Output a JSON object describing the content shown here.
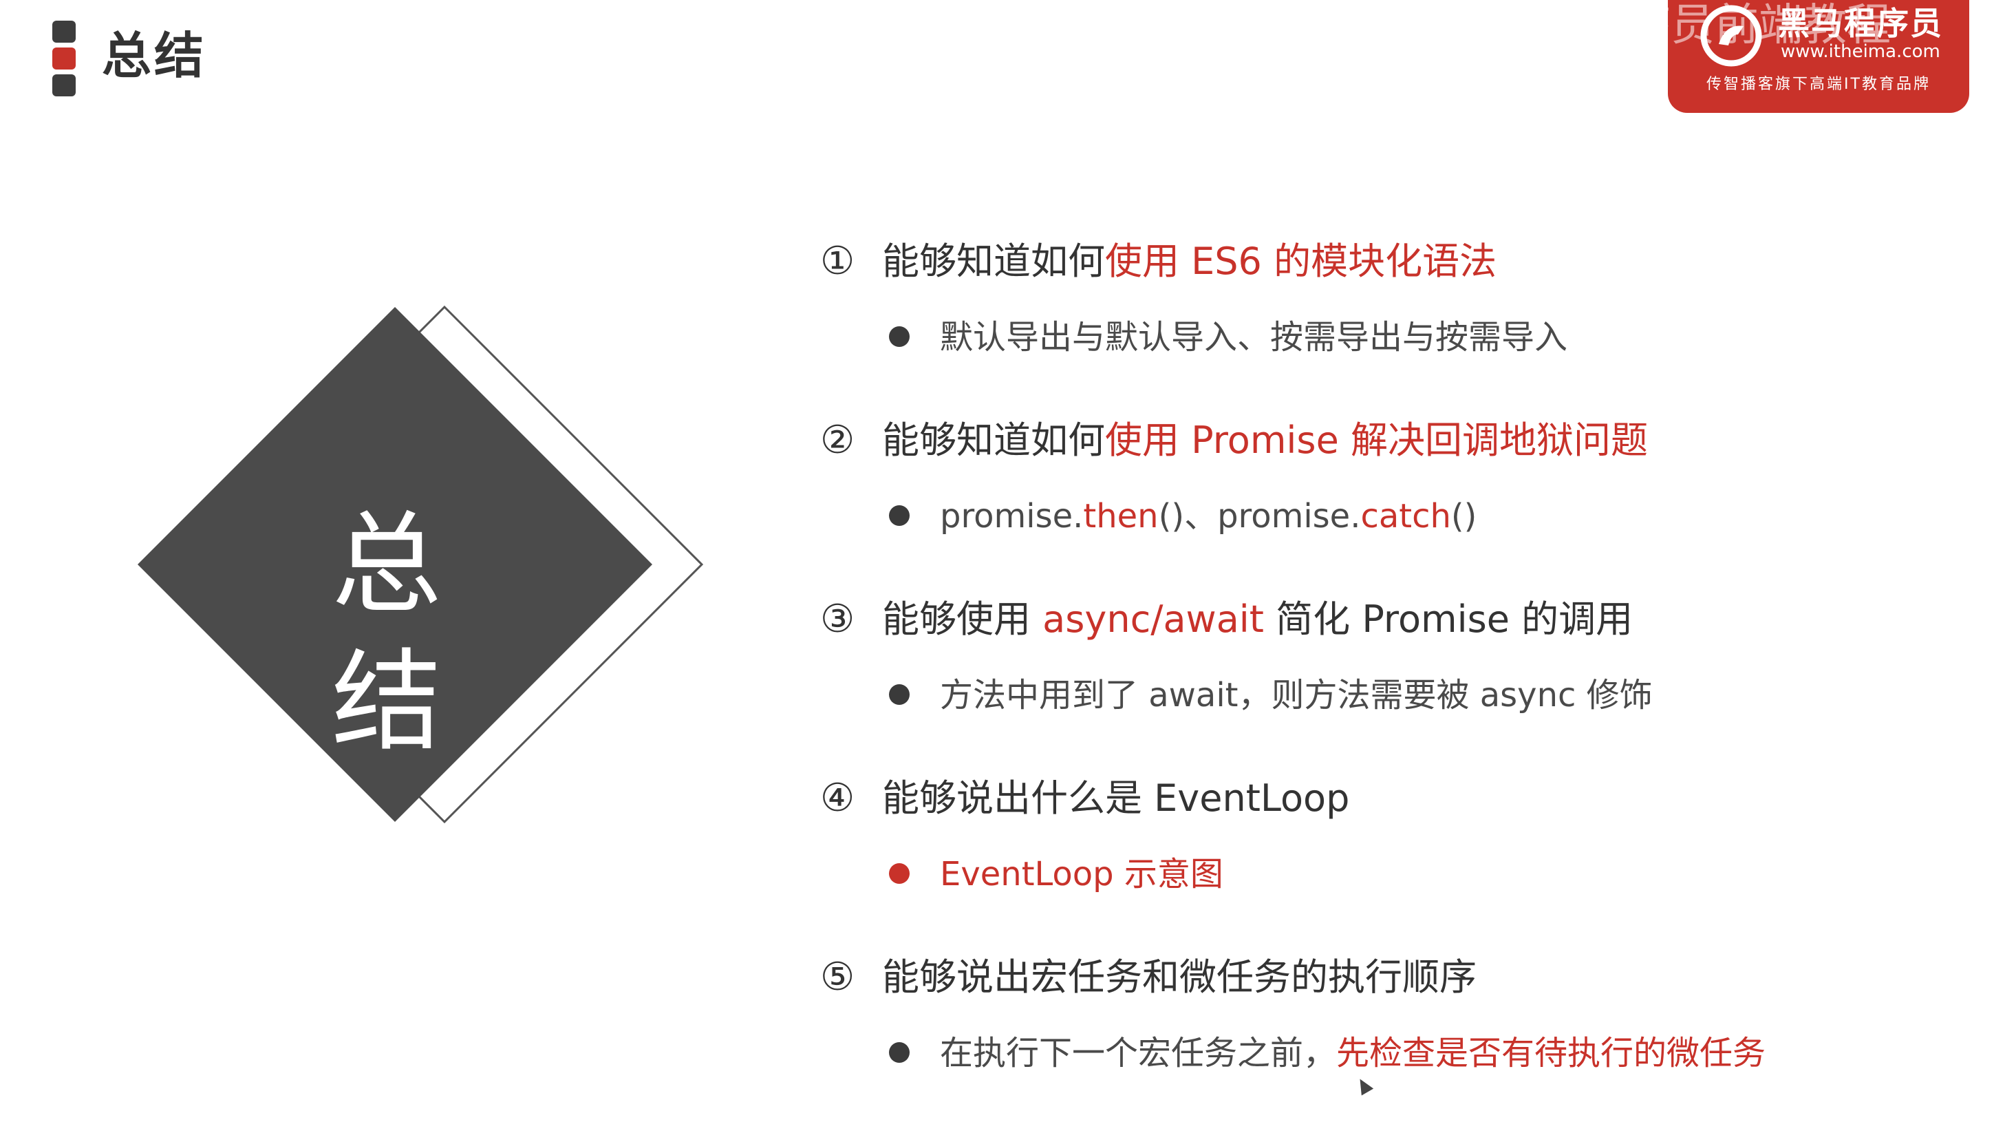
{
  "header": {
    "title": "总结"
  },
  "brand": {
    "name": "黑马程序员",
    "url": "www.itheima.com",
    "slogan": "传智播客旗下高端IT教育品牌",
    "watermark": "程序员前端教程",
    "logo_icon": "horse-logo-icon"
  },
  "diamond": {
    "label": "总结"
  },
  "items": [
    {
      "num": "①",
      "heading_prefix": "能够知道如何",
      "heading_highlight": "使用 ES6 的模块化语法",
      "bullet": "默认导出与默认导入、按需导出与按需导入"
    },
    {
      "num": "②",
      "heading_prefix": "能够知道如何",
      "heading_highlight": "使用 Promise 解决回调地狱问题",
      "bullet_parts": [
        "promise.",
        "then",
        "()、promise.",
        "catch",
        "()"
      ]
    },
    {
      "num": "③",
      "heading_prefix": "能够使用 ",
      "heading_highlight": "async/await",
      "heading_suffix": " 简化 Promise 的调用",
      "bullet": "方法中用到了 await，则方法需要被 async 修饰"
    },
    {
      "num": "④",
      "heading_prefix": "能够说出什么是 EventLoop",
      "bullet_highlight": "EventLoop 示意图"
    },
    {
      "num": "⑤",
      "heading_prefix": "能够说出宏任务和微任务的执行顺序",
      "bullet_prefix": "在执行下一个宏任务之前，",
      "bullet_highlight": "先检查是否有待执行的微任务"
    }
  ],
  "colors": {
    "accent": "#c8322a",
    "dark": "#4b4b4b",
    "text": "#3a3a3a"
  }
}
